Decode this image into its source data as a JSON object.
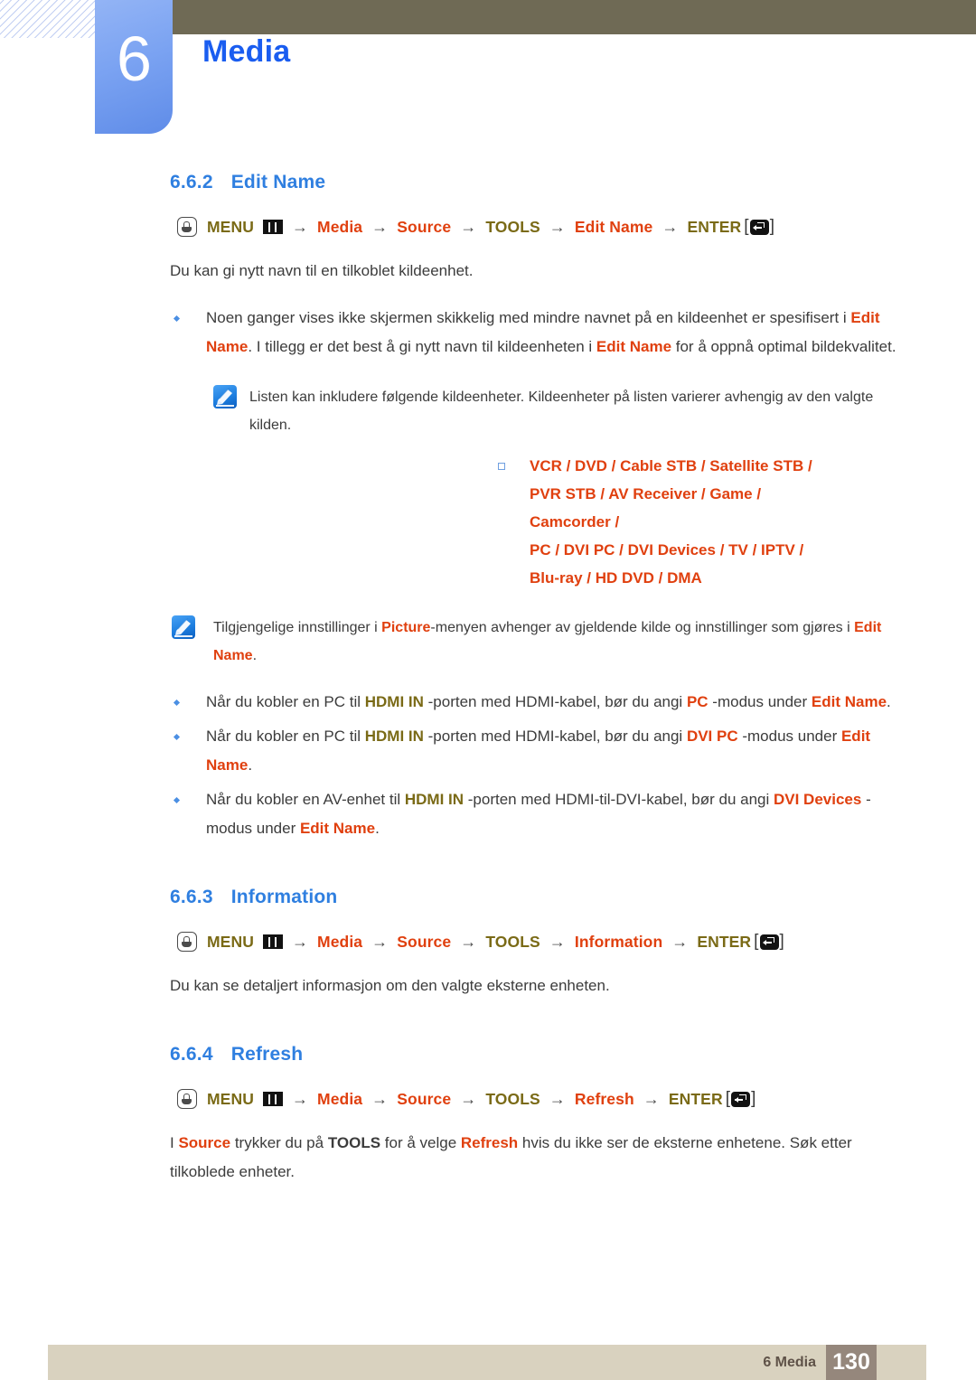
{
  "header": {
    "chapter_number": "6",
    "chapter_title": "Media"
  },
  "sections": [
    {
      "number": "6.6.2",
      "title": "Edit Name",
      "menu_path": {
        "items": [
          {
            "text": "MENU",
            "color": "olive"
          },
          {
            "text": "Media",
            "color": "red"
          },
          {
            "text": "Source",
            "color": "red"
          },
          {
            "text": "TOOLS",
            "color": "olive"
          },
          {
            "text": "Edit Name",
            "color": "red"
          },
          {
            "text": "ENTER",
            "color": "olive"
          }
        ],
        "arrow": "→",
        "bracket_open": "[",
        "bracket_close": "]"
      },
      "intro": "Du kan gi nytt navn til en tilkoblet kildeenhet."
    },
    {
      "number": "6.6.3",
      "title": "Information",
      "menu_path": {
        "items": [
          {
            "text": "MENU",
            "color": "olive"
          },
          {
            "text": "Media",
            "color": "red"
          },
          {
            "text": "Source",
            "color": "red"
          },
          {
            "text": "TOOLS",
            "color": "olive"
          },
          {
            "text": "Information",
            "color": "red"
          },
          {
            "text": "ENTER",
            "color": "olive"
          }
        ]
      },
      "intro": "Du kan se detaljert informasjon om den valgte eksterne enheten."
    },
    {
      "number": "6.6.4",
      "title": "Refresh",
      "menu_path": {
        "items": [
          {
            "text": "MENU",
            "color": "olive"
          },
          {
            "text": "Media",
            "color": "red"
          },
          {
            "text": "Source",
            "color": "red"
          },
          {
            "text": "TOOLS",
            "color": "olive"
          },
          {
            "text": "Refresh",
            "color": "red"
          },
          {
            "text": "ENTER",
            "color": "olive"
          }
        ]
      }
    }
  ],
  "bullets": {
    "b1_a": "Noen ganger vises ikke skjermen skikkelig med mindre navnet på en kildeenhet er spesifisert i ",
    "b1_em1": "Edit Name",
    "b1_b": ". I tillegg er det best å gi nytt navn til kildeenheten i ",
    "b1_em2": "Edit Name",
    "b1_c": " for å oppnå optimal bildekvalitet.",
    "b2_a": "Når du kobler en PC til ",
    "b2_em1": "HDMI IN",
    "b2_b": " -porten med HDMI-kabel, bør du angi ",
    "b2_em2": "PC",
    "b2_c": " -modus under ",
    "b2_em3": "Edit Name",
    "b2_d": ".",
    "b3_a": "Når du kobler en PC til ",
    "b3_em1": "HDMI IN",
    "b3_b": " -porten med HDMI-kabel, bør du angi ",
    "b3_em2": "DVI PC",
    "b3_c": " -modus under ",
    "b3_em3": "Edit Name",
    "b3_d": ".",
    "b4_a": "Når du kobler en AV-enhet til ",
    "b4_em1": "HDMI IN",
    "b4_b": " -porten med HDMI-til-DVI-kabel, bør du angi ",
    "b4_em2": "DVI Devices",
    "b4_c": " -modus under ",
    "b4_em3": "Edit Name",
    "b4_d": "."
  },
  "notes": {
    "note1_text": "Listen kan inkludere følgende kildeenheter. Kildeenheter på listen varierer avhengig av den valgte kilden.",
    "note2_a": "Tilgjengelige innstillinger i ",
    "note2_em1": "Picture",
    "note2_b": "-menyen avhenger av gjeldende kilde og innstillinger som gjøres i ",
    "note2_em2": "Edit Name",
    "note2_c": "."
  },
  "device_list": {
    "line1": "VCR / DVD / Cable STB / Satellite STB / PVR STB / AV Receiver / Game / Camcorder /",
    "line2": "PC / DVI PC / DVI Devices / TV / IPTV / Blu-ray / HD DVD / DMA"
  },
  "refresh_paragraph": {
    "a": "I ",
    "em1": "Source",
    "b": " trykker du på ",
    "em2": "TOOLS",
    "c": " for å velge ",
    "em3": "Refresh",
    "d": " hvis du ikke ser de eksterne enhetene. Søk etter tilkoblede enheter."
  },
  "footer": {
    "label": "6 Media",
    "page_number": "130"
  },
  "colors": {
    "accent_blue": "#2f7fe0",
    "title_blue": "#1a5df0",
    "emphasis_red": "#e0400f",
    "emphasis_olive": "#7a6a16",
    "header_olive": "#6f6a55",
    "footer_tan": "#d9d2bf",
    "footer_page_box": "#95877c"
  }
}
